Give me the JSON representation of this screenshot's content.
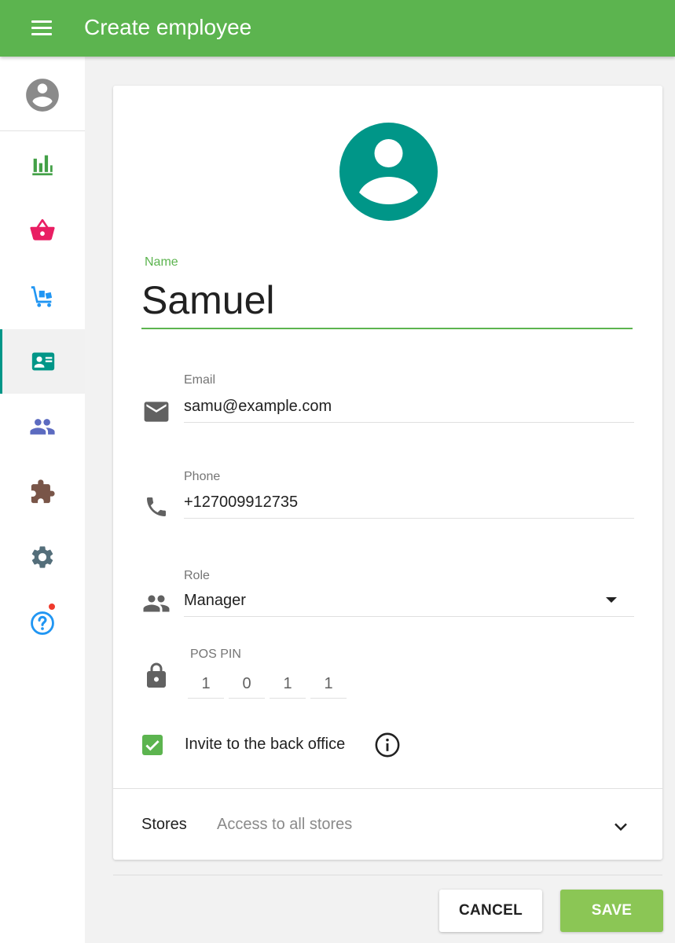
{
  "appbar": {
    "title": "Create employee"
  },
  "sidebar": {
    "items": [
      {
        "id": "reports",
        "icon": "bar-chart-icon",
        "color": "#43a047"
      },
      {
        "id": "items",
        "icon": "basket-icon",
        "color": "#e91e63"
      },
      {
        "id": "inventory",
        "icon": "warehouse-cart-icon",
        "color": "#2196f3"
      },
      {
        "id": "employees",
        "icon": "badge-icon",
        "color": "#009688",
        "active": true
      },
      {
        "id": "customers",
        "icon": "people-icon",
        "color": "#5c6bc0"
      },
      {
        "id": "integrations",
        "icon": "puzzle-icon",
        "color": "#795548"
      },
      {
        "id": "settings",
        "icon": "gear-icon",
        "color": "#546e7a"
      },
      {
        "id": "help",
        "icon": "help-icon",
        "color": "#2196f3",
        "notification": true
      }
    ]
  },
  "form": {
    "name": {
      "label": "Name",
      "value": "Samuel"
    },
    "email": {
      "label": "Email",
      "value": "samu@example.com"
    },
    "phone": {
      "label": "Phone",
      "value": "+127009912735"
    },
    "role": {
      "label": "Role",
      "value": "Manager"
    },
    "pin": {
      "label": "POS PIN",
      "digits": [
        "1",
        "0",
        "1",
        "1"
      ]
    },
    "invite": {
      "label": "Invite to the back office",
      "checked": true
    },
    "stores": {
      "label": "Stores",
      "value": "Access to all stores"
    }
  },
  "actions": {
    "cancel": "CANCEL",
    "save": "SAVE"
  },
  "colors": {
    "accent": "#5cb44f",
    "avatar": "#009688",
    "save": "#8bc655"
  }
}
